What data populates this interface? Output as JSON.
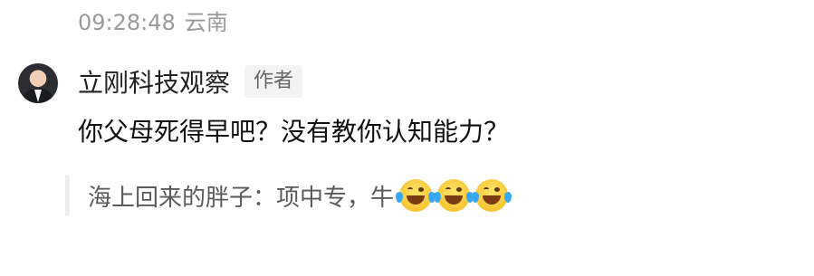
{
  "header": {
    "time": "09:28:48",
    "location": "云南"
  },
  "comment": {
    "author": "立刚科技观察",
    "author_tag": "作者",
    "text": "你父母死得早吧？没有教你认知能力？"
  },
  "quote": {
    "text": "海上回来的胖子：项中专，牛",
    "emojis": [
      "crying-laughing-icon",
      "crying-laughing-icon",
      "crying-laughing-icon"
    ]
  },
  "footer": {
    "blurred_text": ""
  }
}
